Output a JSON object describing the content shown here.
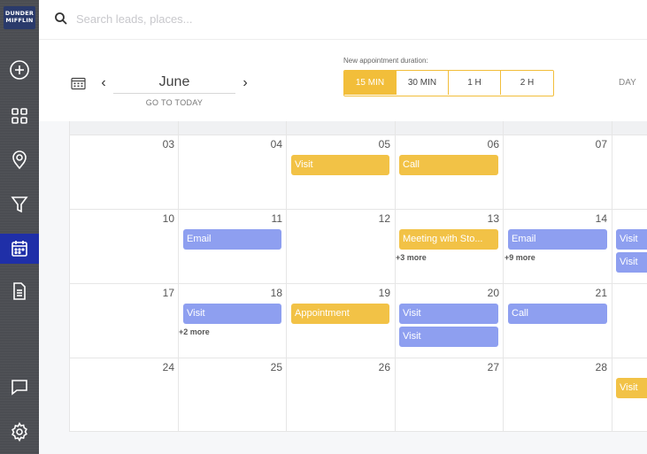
{
  "logo": {
    "line1": "DUNDER",
    "line2": "MIFFLIN",
    "brand_color": "#2a3a6b"
  },
  "sidebar": {
    "items": [
      {
        "icon": "plus-circle-icon"
      },
      {
        "icon": "grid-icon"
      },
      {
        "icon": "map-pin-icon"
      },
      {
        "icon": "filter-icon"
      },
      {
        "icon": "calendar-icon",
        "active": true
      },
      {
        "icon": "document-icon"
      },
      {
        "icon": "chat-icon"
      },
      {
        "icon": "gear-icon"
      }
    ],
    "active_color": "#1f2fa8"
  },
  "search": {
    "placeholder": "Search leads, places..."
  },
  "header": {
    "month": "June",
    "go_today": "GO TO TODAY",
    "duration_label": "New appointment duration:",
    "durations": [
      "15 MIN",
      "30 MIN",
      "1 H",
      "2 H"
    ],
    "active_duration": "15 MIN",
    "view_day": "DAY",
    "accent_color": "#f2be3a"
  },
  "calendar": {
    "weeks": [
      [
        "03",
        "04",
        "05",
        "06",
        "07"
      ],
      [
        "10",
        "11",
        "12",
        "13",
        "14"
      ],
      [
        "17",
        "18",
        "19",
        "20",
        "21"
      ],
      [
        "24",
        "25",
        "26",
        "27",
        "28"
      ]
    ],
    "events": {
      "w1_thu_visit": "Visit",
      "w1_fri_call": "Call",
      "w2_tue_email": "Email",
      "w2_fri_meeting": "Meeting with Sto...",
      "w2_fri_more": "+3 more",
      "w2_sat_email": "Email",
      "w2_sat_more": "+9 more",
      "w2_next_visit1": "Visit",
      "w2_next_visit2": "Visit",
      "w3_tue_visit": "Visit",
      "w3_tue_more": "+2 more",
      "w3_wed_appointment": "Appointment",
      "w3_thu_visit1": "Visit",
      "w3_thu_visit2": "Visit",
      "w3_fri_call": "Call",
      "w4_next_visit": "Visit"
    },
    "colors": {
      "yellow": "#f2c246",
      "blue": "#8e9ff0"
    }
  }
}
